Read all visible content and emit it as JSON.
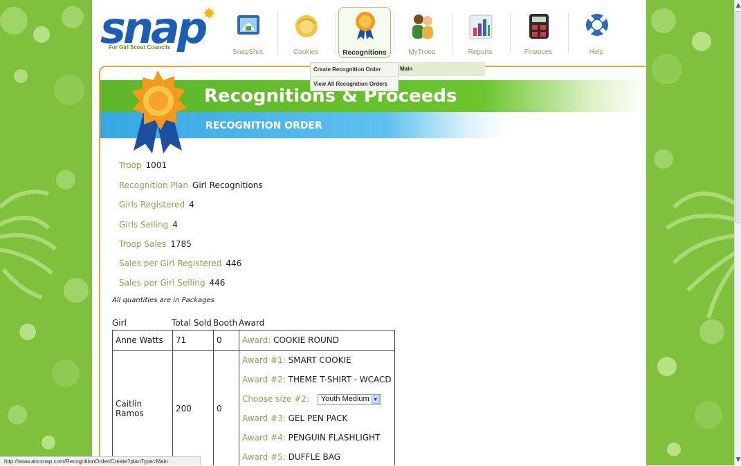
{
  "brand": {
    "name": "snap",
    "tagline": "For Girl Scout Councils",
    "accent": "#1a5fb4"
  },
  "nav": [
    {
      "label": "SnapShot",
      "icon": "snapshot-icon"
    },
    {
      "label": "Cookies",
      "icon": "cookies-icon"
    },
    {
      "label": "Recognitions",
      "icon": "ribbon-icon",
      "active": true
    },
    {
      "label": "MyTroop",
      "icon": "people-icon"
    },
    {
      "label": "Reports",
      "icon": "bar-chart-icon"
    },
    {
      "label": "Finances",
      "icon": "calculator-icon"
    },
    {
      "label": "Help",
      "icon": "life-ring-icon"
    }
  ],
  "dropdown": {
    "items": [
      "Create Recognition Order",
      "View All Recognition Orders"
    ],
    "submenu_label": "Main"
  },
  "header": {
    "title": "Recognitions & Proceeds",
    "subtitle": "RECOGNITION ORDER"
  },
  "summary": [
    {
      "label": "Troop",
      "value": "1001"
    },
    {
      "label": "Recognition Plan",
      "value": "Girl Recognitions"
    },
    {
      "label": "Girls Registered",
      "value": "4"
    },
    {
      "label": "Girls Selling",
      "value": "4"
    },
    {
      "label": "Troop Sales",
      "value": "1785"
    },
    {
      "label": "Sales per Girl Registered",
      "value": "446"
    },
    {
      "label": "Sales per Girl Selling",
      "value": "446"
    }
  ],
  "note": "All quantities are in Packages",
  "table": {
    "headers": [
      "Girl",
      "Total Sold",
      "Booth",
      "Award"
    ],
    "rows": [
      {
        "girl": "Anne Watts",
        "total": "71",
        "booth": "0",
        "awards": [
          {
            "label": "Award:",
            "value": "COOKIE ROUND"
          }
        ]
      },
      {
        "girl": "Caitlin Ramos",
        "total": "200",
        "booth": "0",
        "awards": [
          {
            "label": "Award #1:",
            "value": "SMART COOKIE"
          },
          {
            "label": "Award #2:",
            "value": "THEME T-SHIRT - WCACD"
          },
          {
            "label": "Choose size #2:",
            "select": "Youth Medium"
          },
          {
            "label": "Award #3:",
            "value": "GEL PEN PACK"
          },
          {
            "label": "Award #4:",
            "value": "PENGUIN FLASHLIGHT"
          },
          {
            "label": "Award #5:",
            "value": "DUFFLE BAG"
          }
        ]
      }
    ]
  },
  "status_url": "http://www.abcsnap.com/RecognitionOrder/Create?planType=Main",
  "colors": {
    "side_green": "#7fc13d",
    "label_green": "#7fab4d",
    "header_green": "#5db62a",
    "header_blue": "#36a8e3",
    "frame_orange": "#f5a030"
  }
}
